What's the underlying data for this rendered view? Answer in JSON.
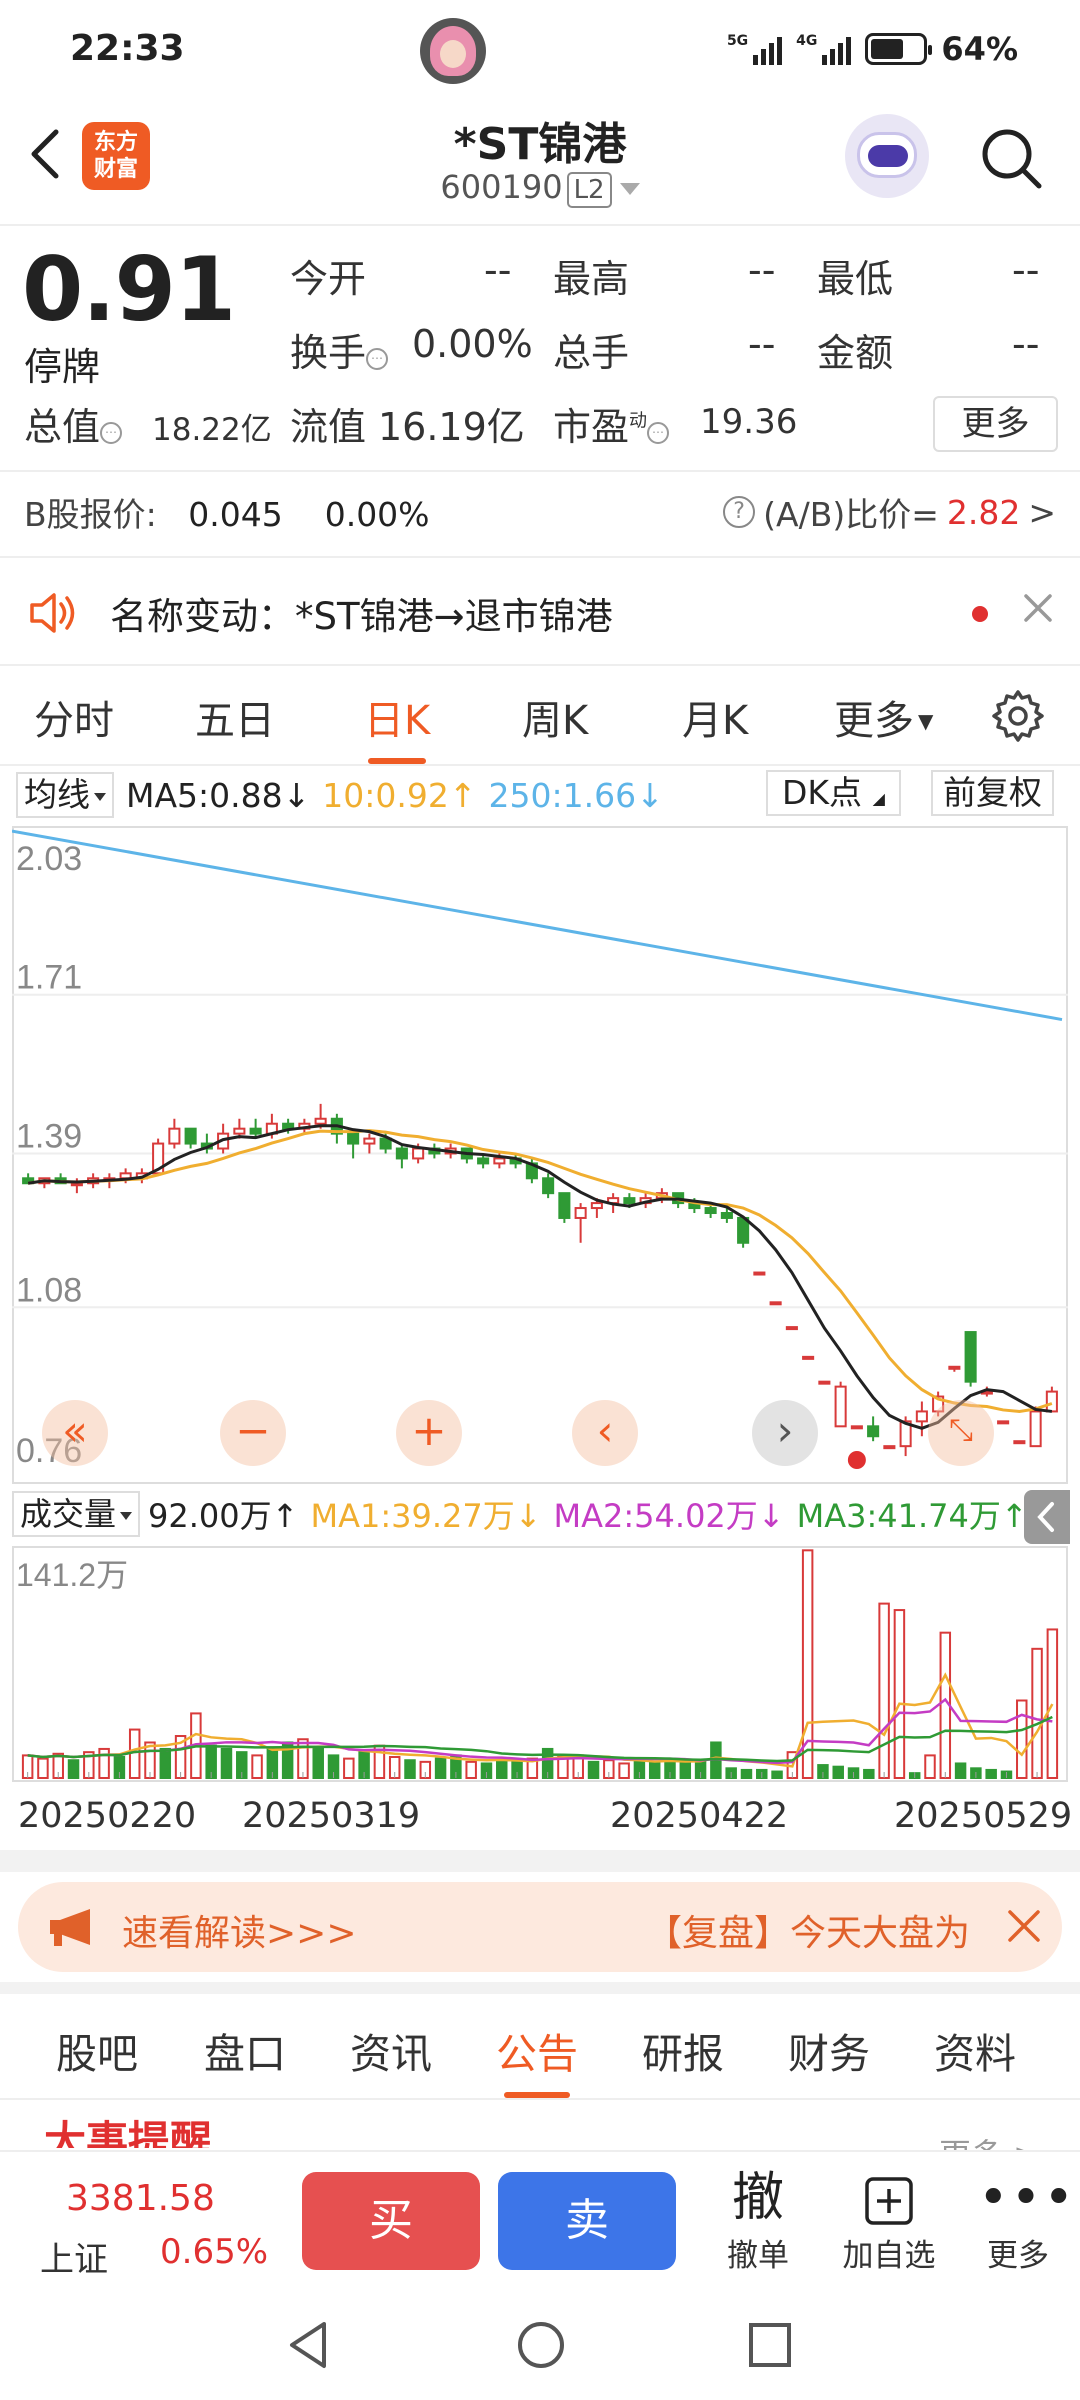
{
  "status_bar": {
    "time": "22:33",
    "battery": "64%",
    "signal1": "5G",
    "signal2": "4G"
  },
  "header": {
    "brand": "东方\n财富",
    "brand_line1": "东方",
    "brand_line2": "财富",
    "stock_name": "*ST锦港",
    "stock_code": "600190",
    "level": "L2"
  },
  "quote": {
    "price": "0.91",
    "status": "停牌",
    "open_label": "今开",
    "open": "--",
    "high_label": "最高",
    "high": "--",
    "low_label": "最低",
    "low": "--",
    "turnover_label": "换手",
    "turnover": "0.00%",
    "volume_label": "总手",
    "volume": "--",
    "amount_label": "金额",
    "amount": "--",
    "mcap_label": "总值",
    "mcap": "18.22亿",
    "float_label": "流值",
    "float_cap": "16.19亿",
    "pe_label": "市盈",
    "pe_sup": "动",
    "pe": "19.36",
    "more": "更多"
  },
  "bshare": {
    "label": "B股报价:",
    "price": "0.045",
    "change": "0.00%",
    "ratio_label": "(A/B)比价=",
    "ratio": "2.82",
    "arrow": ">"
  },
  "notice": {
    "text": "名称变动：*ST锦港→退市锦港"
  },
  "ktabs": [
    "分时",
    "五日",
    "日K",
    "周K",
    "月K",
    "更多"
  ],
  "ma_legend": {
    "selector": "均线",
    "ma5": "MA5:0.88",
    "ma10": "10:0.92",
    "ma250": "250:1.66",
    "dk": "DK点",
    "adjust": "前复权"
  },
  "vol_legend": {
    "selector": "成交量",
    "vol": "92.00万",
    "ma1": "MA1:39.27万",
    "ma2": "MA2:54.02万",
    "ma3": "MA3:41.74万"
  },
  "chart_data": [
    {
      "type": "candlestick",
      "title": "",
      "y_ticks": [
        "2.03",
        "1.71",
        "1.39",
        "1.08",
        "0.76"
      ],
      "ylim": [
        0.76,
        2.03
      ],
      "ma_colors": {
        "ma5": "#222222",
        "ma10": "#f0ae30",
        "ma250": "#5db4e8"
      },
      "up_color": "#d83a3a",
      "down_color": "#2f9a35",
      "candles": [
        [
          1.34,
          1.35,
          1.33,
          1.33
        ],
        [
          1.33,
          1.34,
          1.32,
          1.34
        ],
        [
          1.34,
          1.35,
          1.33,
          1.33
        ],
        [
          1.33,
          1.34,
          1.31,
          1.33
        ],
        [
          1.33,
          1.35,
          1.32,
          1.34
        ],
        [
          1.34,
          1.35,
          1.32,
          1.34
        ],
        [
          1.34,
          1.36,
          1.33,
          1.35
        ],
        [
          1.34,
          1.36,
          1.33,
          1.35
        ],
        [
          1.35,
          1.42,
          1.35,
          1.41
        ],
        [
          1.41,
          1.46,
          1.4,
          1.44
        ],
        [
          1.44,
          1.44,
          1.4,
          1.41
        ],
        [
          1.41,
          1.43,
          1.39,
          1.4
        ],
        [
          1.4,
          1.45,
          1.39,
          1.43
        ],
        [
          1.43,
          1.46,
          1.42,
          1.44
        ],
        [
          1.44,
          1.46,
          1.42,
          1.43
        ],
        [
          1.43,
          1.47,
          1.42,
          1.45
        ],
        [
          1.45,
          1.46,
          1.43,
          1.44
        ],
        [
          1.44,
          1.46,
          1.43,
          1.45
        ],
        [
          1.45,
          1.49,
          1.44,
          1.46
        ],
        [
          1.46,
          1.47,
          1.41,
          1.43
        ],
        [
          1.43,
          1.44,
          1.38,
          1.41
        ],
        [
          1.41,
          1.43,
          1.39,
          1.42
        ],
        [
          1.42,
          1.43,
          1.39,
          1.4
        ],
        [
          1.4,
          1.41,
          1.36,
          1.38
        ],
        [
          1.38,
          1.41,
          1.37,
          1.4
        ],
        [
          1.4,
          1.41,
          1.38,
          1.39
        ],
        [
          1.39,
          1.41,
          1.38,
          1.4
        ],
        [
          1.4,
          1.4,
          1.37,
          1.38
        ],
        [
          1.38,
          1.39,
          1.36,
          1.37
        ],
        [
          1.37,
          1.39,
          1.36,
          1.38
        ],
        [
          1.38,
          1.39,
          1.36,
          1.37
        ],
        [
          1.37,
          1.38,
          1.33,
          1.34
        ],
        [
          1.34,
          1.35,
          1.3,
          1.31
        ],
        [
          1.31,
          1.31,
          1.25,
          1.26
        ],
        [
          1.26,
          1.29,
          1.21,
          1.28
        ],
        [
          1.28,
          1.3,
          1.26,
          1.29
        ],
        [
          1.29,
          1.31,
          1.27,
          1.3
        ],
        [
          1.3,
          1.31,
          1.28,
          1.29
        ],
        [
          1.29,
          1.31,
          1.28,
          1.3
        ],
        [
          1.3,
          1.32,
          1.29,
          1.31
        ],
        [
          1.31,
          1.31,
          1.28,
          1.29
        ],
        [
          1.29,
          1.3,
          1.27,
          1.28
        ],
        [
          1.28,
          1.29,
          1.26,
          1.27
        ],
        [
          1.27,
          1.28,
          1.25,
          1.26
        ],
        [
          1.26,
          1.26,
          1.2,
          1.21
        ],
        [
          1.15,
          1.15,
          1.15,
          1.15
        ],
        [
          1.09,
          1.09,
          1.09,
          1.09
        ],
        [
          1.04,
          1.04,
          1.04,
          1.04
        ],
        [
          0.98,
          0.98,
          0.98,
          0.98
        ],
        [
          0.93,
          0.93,
          0.93,
          0.93
        ],
        [
          0.84,
          0.93,
          0.84,
          0.92
        ],
        [
          0.84,
          0.84,
          0.84,
          0.84
        ],
        [
          0.84,
          0.86,
          0.81,
          0.82
        ],
        [
          0.8,
          0.8,
          0.8,
          0.8
        ],
        [
          0.8,
          0.86,
          0.78,
          0.85
        ],
        [
          0.85,
          0.89,
          0.82,
          0.87
        ],
        [
          0.87,
          0.91,
          0.86,
          0.9
        ],
        [
          0.96,
          0.96,
          0.95,
          0.96
        ],
        [
          1.03,
          1.03,
          0.92,
          0.93
        ],
        [
          0.91,
          0.92,
          0.9,
          0.91
        ],
        [
          0.85,
          0.85,
          0.85,
          0.85
        ],
        [
          0.81,
          0.81,
          0.81,
          0.81
        ],
        [
          0.8,
          0.88,
          0.8,
          0.87
        ],
        [
          0.87,
          0.92,
          0.87,
          0.91
        ]
      ]
    },
    {
      "type": "bar",
      "title": "",
      "y_max_label": "141.2万",
      "ylim": [
        0,
        141.2
      ],
      "x_ticks": [
        "20250220",
        "20250319",
        "20250422",
        "20250529"
      ],
      "vol_ma_colors": {
        "ma1": "#f0ae30",
        "ma2": "#c43cc4",
        "ma3": "#2f9a35"
      },
      "volumes": [
        14,
        12,
        15,
        11,
        16,
        18,
        13,
        30,
        22,
        18,
        26,
        40,
        20,
        18,
        16,
        14,
        19,
        22,
        24,
        18,
        14,
        12,
        16,
        20,
        13,
        11,
        10,
        12,
        14,
        10,
        9,
        11,
        10,
        12,
        18,
        13,
        14,
        10,
        11,
        9,
        11,
        10,
        12,
        9,
        10,
        22,
        6,
        5,
        5,
        4,
        16,
        141,
        8,
        7,
        6,
        5,
        108,
        104,
        3,
        14,
        90,
        9,
        6,
        5,
        4,
        48,
        80,
        92
      ],
      "up_flags": [
        1,
        1,
        1,
        0,
        1,
        1,
        0,
        1,
        1,
        0,
        1,
        1,
        0,
        0,
        0,
        1,
        0,
        0,
        1,
        0,
        0,
        1,
        0,
        1,
        1,
        0,
        1,
        0,
        0,
        1,
        0,
        0,
        0,
        1,
        0,
        1,
        1,
        0,
        1,
        1,
        0,
        0,
        0,
        0,
        0,
        0,
        0,
        0,
        0,
        0,
        1,
        1,
        0,
        0,
        0,
        0,
        1,
        1,
        0,
        1,
        1,
        0,
        0,
        0,
        0,
        1,
        1,
        1
      ]
    }
  ],
  "nav_arrows": [
    "«",
    "−",
    "+",
    "‹",
    "›"
  ],
  "promo": {
    "left": "速看解读>>>",
    "right": "【复盘】今天大盘为"
  },
  "news_tabs": [
    "股吧",
    "盘口",
    "资讯",
    "公告",
    "研报",
    "财务",
    "资料"
  ],
  "bigevent": {
    "title": "大事提醒",
    "more": "更多 >"
  },
  "actionbar": {
    "index_value": "3381.58",
    "index_name": "上证",
    "index_pct": "0.65%",
    "buy": "买",
    "sell": "卖",
    "withdraw_icon": "撤",
    "withdraw": "撤单",
    "add_watch": "加自选",
    "more": "更多"
  }
}
